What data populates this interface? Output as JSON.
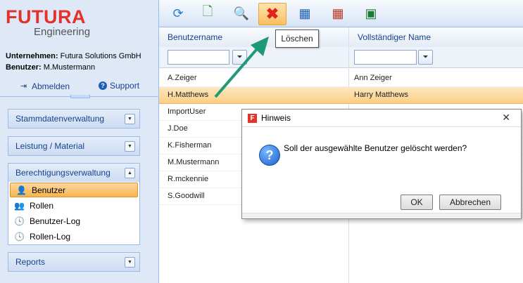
{
  "logo": {
    "main": "FUTURA",
    "sub": "Engineering"
  },
  "account": {
    "company_label": "Unternehmen:",
    "company": "Futura Solutions GmbH",
    "user_label": "Benutzer:",
    "user": "M.Mustermann",
    "logout": "Abmelden",
    "support": "Support"
  },
  "nav": {
    "stammdaten": "Stammdatenverwaltung",
    "leistung": "Leistung / Material",
    "berechtigung": "Berechtigungsverwaltung",
    "items": [
      "Benutzer",
      "Rollen",
      "Benutzer-Log",
      "Rollen-Log"
    ],
    "reports": "Reports"
  },
  "toolbar": {
    "icons": [
      "refresh-icon",
      "add-icon",
      "search-icon",
      "delete-icon",
      "save-icon",
      "edit-icon",
      "excel-icon"
    ],
    "tooltip": "Löschen"
  },
  "grid": {
    "columns": [
      "Benutzername",
      "Vollständiger Name"
    ],
    "rows": [
      {
        "user": "A.Zeiger",
        "name": "Ann Zeiger"
      },
      {
        "user": "H.Matthews",
        "name": "Harry Matthews"
      },
      {
        "user": "ImportUser",
        "name": ""
      },
      {
        "user": "J.Doe",
        "name": ""
      },
      {
        "user": "K.Fisherman",
        "name": ""
      },
      {
        "user": "M.Mustermann",
        "name": ""
      },
      {
        "user": "R.mckennie",
        "name": ""
      },
      {
        "user": "S.Goodwill",
        "name": ""
      }
    ],
    "selected_row": 1
  },
  "dialog": {
    "title": "Hinweis",
    "message": "Soll der ausgewählte Benutzer gelöscht werden?",
    "ok": "OK",
    "cancel": "Abbrechen"
  },
  "colors": {
    "brand": "#e4322b",
    "accent": "#15428b",
    "highlight": "#f8b44e"
  }
}
